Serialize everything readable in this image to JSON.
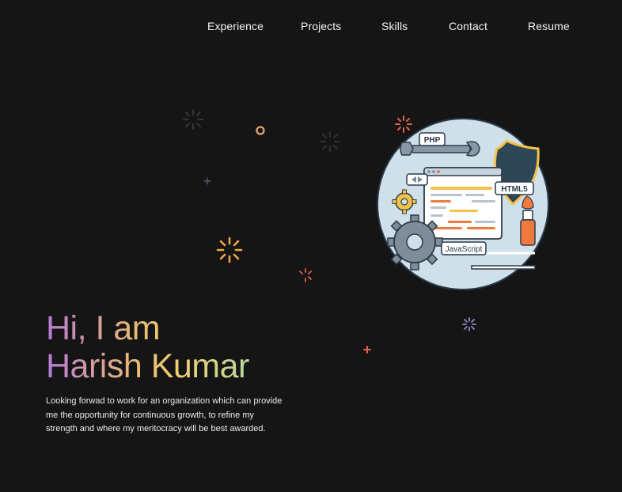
{
  "nav": {
    "items": [
      {
        "label": "Experience"
      },
      {
        "label": "Projects"
      },
      {
        "label": "Skills"
      },
      {
        "label": "Contact"
      },
      {
        "label": "Resume"
      }
    ]
  },
  "hero": {
    "greeting": "Hi, I am",
    "name": "Harish Kumar",
    "description": "Looking forwad to work for an organization which can provide me the opportunity for continuous growth, to refine my strength and where my meritocracy will be best awarded."
  },
  "illustration": {
    "tags": {
      "php": "PHP",
      "html5": "HTML5",
      "javascript": "JavaScript"
    }
  },
  "colors": {
    "background": "#151515",
    "gradient_start": "#b57bd8",
    "gradient_mid": "#e9bb72",
    "gradient_end": "#b8d99a",
    "circle_fill": "#cfe0ea",
    "accent_orange": "#f07a3e",
    "accent_yellow": "#f2c34a"
  }
}
